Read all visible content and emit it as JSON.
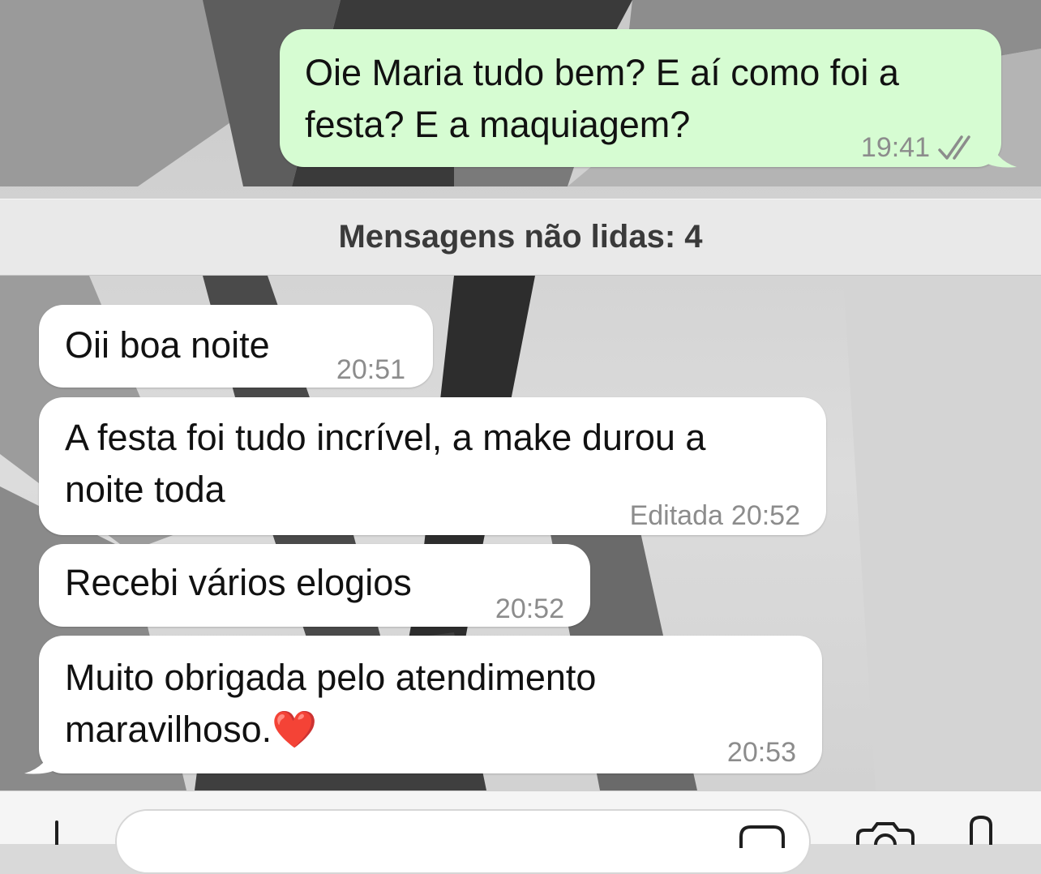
{
  "messages": [
    {
      "direction": "outgoing",
      "line1": "Oie Maria tudo bem? E aí como foi a",
      "line2": "festa? E a maquiagem?",
      "time": "19:41",
      "status_icon": "double-check-icon"
    },
    {
      "direction": "incoming",
      "line1": "Oii boa noite",
      "time": "20:51"
    },
    {
      "direction": "incoming",
      "line1": "A festa foi tudo incrível, a make durou a",
      "line2": "noite toda",
      "edited_label": "Editada",
      "time": "20:52"
    },
    {
      "direction": "incoming",
      "line1": "Recebi vários elogios",
      "time": "20:52"
    },
    {
      "direction": "incoming",
      "line1": "Muito obrigada pelo atendimento",
      "line2": "maravilhoso.",
      "emoji": "❤️",
      "time": "20:53"
    }
  ],
  "unread_banner": "Mensagens não lidas: 4",
  "input_bar": {
    "left_icon": "plus-icon",
    "field_icon": "sticker-icon",
    "camera_icon": "camera-icon",
    "mic_icon": "microphone-icon"
  },
  "colors": {
    "outgoing_bubble": "#d6fcd2",
    "incoming_bubble": "#ffffff",
    "meta_text": "#8c8c8c"
  }
}
